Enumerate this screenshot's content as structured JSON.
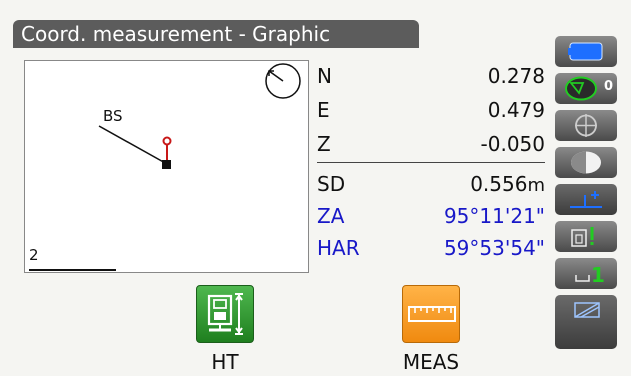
{
  "header": {
    "title": "Coord. measurement - Graphic"
  },
  "plot": {
    "target_label": "BS",
    "scale_label": "2"
  },
  "measurements": {
    "n": {
      "label": "N",
      "value": "0.278"
    },
    "e": {
      "label": "E",
      "value": "0.479"
    },
    "z": {
      "label": "Z",
      "value": "-0.050"
    },
    "sd": {
      "label": "SD",
      "value": "0.556",
      "unit": "m"
    },
    "za": {
      "label": "ZA",
      "value": "95°11'21\""
    },
    "har": {
      "label": "HAR",
      "value": "59°53'54\""
    }
  },
  "side_panel": {
    "laser_count": "0"
  },
  "softkeys": {
    "ht_label": "HT",
    "meas_label": "MEAS"
  },
  "colors": {
    "title_bg": "#5c5c5c",
    "angle_text": "#1818c8",
    "ht_button": "#2e9a2e",
    "meas_button": "#f59a1e",
    "battery": "#1e6fff",
    "laser_icon": "#22cc22"
  }
}
